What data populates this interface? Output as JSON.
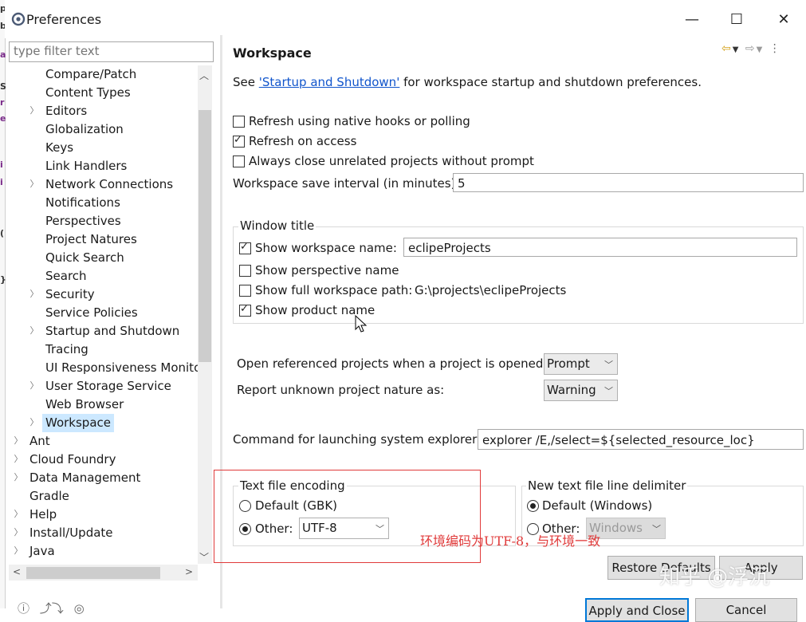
{
  "window": {
    "title": "Preferences",
    "minimize": "—",
    "maximize": "☐",
    "close": "✕"
  },
  "left_panel": {
    "filter_placeholder": "type filter text",
    "tree": [
      {
        "label": "Compare/Patch",
        "level": 1,
        "expandable": false
      },
      {
        "label": "Content Types",
        "level": 1,
        "expandable": false
      },
      {
        "label": "Editors",
        "level": 1,
        "expandable": true
      },
      {
        "label": "Globalization",
        "level": 1,
        "expandable": false
      },
      {
        "label": "Keys",
        "level": 1,
        "expandable": false
      },
      {
        "label": "Link Handlers",
        "level": 1,
        "expandable": false
      },
      {
        "label": "Network Connections",
        "level": 1,
        "expandable": true
      },
      {
        "label": "Notifications",
        "level": 1,
        "expandable": false
      },
      {
        "label": "Perspectives",
        "level": 1,
        "expandable": false
      },
      {
        "label": "Project Natures",
        "level": 1,
        "expandable": false
      },
      {
        "label": "Quick Search",
        "level": 1,
        "expandable": false
      },
      {
        "label": "Search",
        "level": 1,
        "expandable": false
      },
      {
        "label": "Security",
        "level": 1,
        "expandable": true
      },
      {
        "label": "Service Policies",
        "level": 1,
        "expandable": false
      },
      {
        "label": "Startup and Shutdown",
        "level": 1,
        "expandable": true
      },
      {
        "label": "Tracing",
        "level": 1,
        "expandable": false
      },
      {
        "label": "UI Responsiveness Monito",
        "level": 1,
        "expandable": false
      },
      {
        "label": "User Storage Service",
        "level": 1,
        "expandable": true
      },
      {
        "label": "Web Browser",
        "level": 1,
        "expandable": false
      },
      {
        "label": "Workspace",
        "level": 1,
        "expandable": true,
        "selected": true
      },
      {
        "label": "Ant",
        "level": 0,
        "expandable": true
      },
      {
        "label": "Cloud Foundry",
        "level": 0,
        "expandable": true
      },
      {
        "label": "Data Management",
        "level": 0,
        "expandable": true
      },
      {
        "label": "Gradle",
        "level": 0,
        "expandable": false
      },
      {
        "label": "Help",
        "level": 0,
        "expandable": true
      },
      {
        "label": "Install/Update",
        "level": 0,
        "expandable": true
      },
      {
        "label": "Java",
        "level": 0,
        "expandable": true
      }
    ]
  },
  "page": {
    "title": "Workspace",
    "see_prefix": "See ",
    "see_link": "'Startup and Shutdown'",
    "see_suffix": " for workspace startup and shutdown preferences.",
    "refresh_native": {
      "label": "Refresh using native hooks or polling",
      "checked": false
    },
    "refresh_access": {
      "label": "Refresh on access",
      "checked": true
    },
    "always_close": {
      "label": "Always close unrelated projects without prompt",
      "checked": false
    },
    "save_interval_label": "Workspace save interval (in minutes):",
    "save_interval_value": "5",
    "window_title_group": {
      "title": "Window title",
      "show_workspace_name": {
        "label": "Show workspace name:",
        "checked": true,
        "value": "eclipeProjects"
      },
      "show_perspective_name": {
        "label": "Show perspective name",
        "checked": false
      },
      "show_full_path": {
        "label": "Show full workspace path:",
        "checked": false,
        "value": "G:\\projects\\eclipeProjects"
      },
      "show_product_name": {
        "label": "Show product name",
        "checked": true
      }
    },
    "open_referenced": {
      "label": "Open referenced projects when a project is opened:",
      "value": "Prompt"
    },
    "report_unknown": {
      "label": "Report unknown project nature as:",
      "value": "Warning"
    },
    "explorer_cmd": {
      "label": "Command for launching system explorer:",
      "value": "explorer /E,/select=${selected_resource_loc}"
    },
    "encoding_group": {
      "title": "Text file encoding",
      "default_label": "Default (GBK)",
      "other_label": "Other:",
      "other_value": "UTF-8",
      "selected": "other"
    },
    "delimiter_group": {
      "title": "New text file line delimiter",
      "default_label": "Default (Windows)",
      "other_label": "Other:",
      "other_value": "Windows",
      "selected": "default"
    },
    "restore_defaults": "Restore Defaults",
    "apply": "Apply"
  },
  "footer": {
    "apply_close": "Apply and Close",
    "cancel": "Cancel"
  },
  "annotation": {
    "text": "环境编码为UTF-8，与环境一致",
    "color": "#e03a3a"
  },
  "watermark": "知乎 @浮沉"
}
